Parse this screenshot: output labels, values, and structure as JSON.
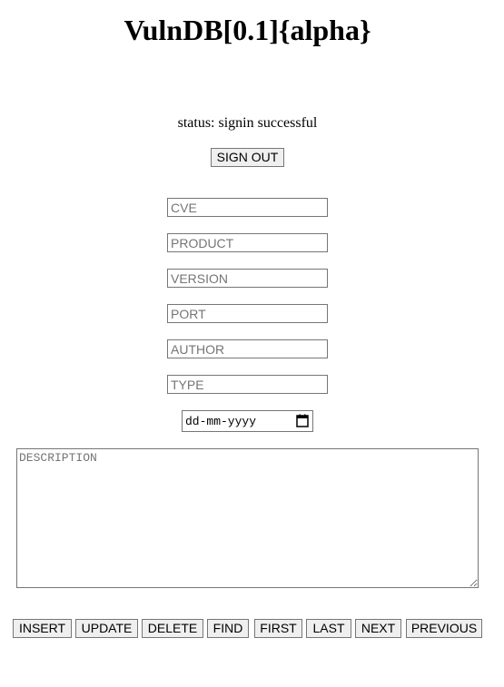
{
  "app": {
    "title": "VulnDB[0.1]{alpha}"
  },
  "status": {
    "text": "status: signin successful"
  },
  "auth": {
    "signout_label": "SIGN OUT"
  },
  "form": {
    "cve_placeholder": "CVE",
    "product_placeholder": "PRODUCT",
    "version_placeholder": "VERSION",
    "port_placeholder": "PORT",
    "author_placeholder": "AUTHOR",
    "type_placeholder": "TYPE",
    "date_placeholder": "dd-mm-yyyy",
    "date_icon": "calendar-icon",
    "description_placeholder": "DESCRIPTION"
  },
  "actions": {
    "insert": "INSERT",
    "update": "UPDATE",
    "delete": "DELETE",
    "find": "FIND",
    "first": "FIRST",
    "last": "LAST",
    "next": "NEXT",
    "previous": "PREVIOUS"
  }
}
